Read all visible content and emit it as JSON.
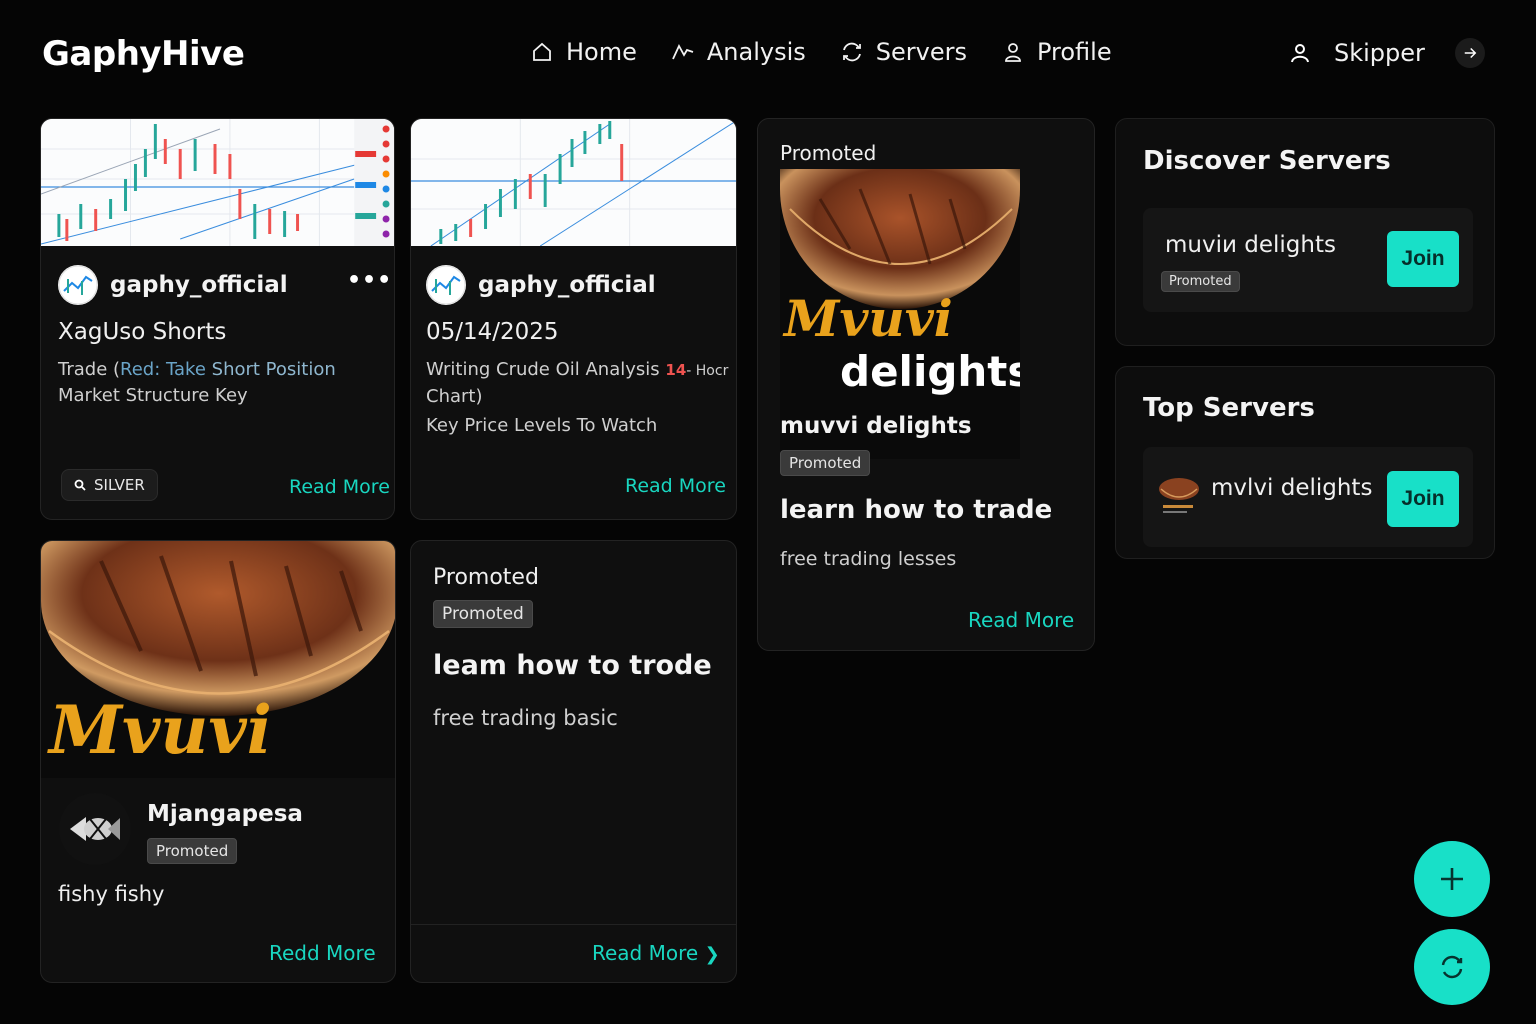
{
  "app": {
    "logo": "GaphyHive"
  },
  "nav": [
    {
      "label": "Home",
      "icon": "home-icon"
    },
    {
      "label": "Analysis",
      "icon": "analysis-icon"
    },
    {
      "label": "Servers",
      "icon": "servers-icon"
    },
    {
      "label": "Profile",
      "icon": "profile-icon"
    }
  ],
  "user": {
    "name": "Skipper"
  },
  "colors": {
    "accent": "#18e0c8",
    "background": "#050505",
    "card": "#0f0f0f"
  },
  "posts": {
    "p1": {
      "author": "gaphy_official",
      "more": "•••",
      "title": "XagUso Shorts",
      "line1_prefix": "Trade (",
      "line1_highlight": "Red: Take",
      "line1_suffix": " Short Position",
      "line2": "Market Structure Key",
      "badge": "SILVER",
      "read_more": "Read More"
    },
    "p2": {
      "author": "gaphy_official",
      "title": "05/14/2025",
      "line1": "Writing Crude Oil Analysis",
      "line1_num": "14",
      "line1_tail": "- Hocr",
      "line2": "Chart)",
      "line3": "Key Price Levels To Watch",
      "read_more": "Read More"
    },
    "p3": {
      "promoted_label": "Promoted",
      "image_script": "Mvuvi",
      "image_word": "delights",
      "name": "muvvi delights",
      "badge": "Promoted",
      "title": "learn how to trade",
      "subtitle": "free trading lesses",
      "read_more": "Read More"
    },
    "p4": {
      "image_script": "Mvuvi",
      "author": "Mjangapesa",
      "badge": "Promoted",
      "body": "fishy fishy",
      "read_more": "Redd More"
    },
    "p5": {
      "promoted_label": "Promoted",
      "badge": "Promoted",
      "title": "leam how to trode",
      "subtitle": "free trading basic",
      "read_more": "Read More",
      "chevron": "❯"
    }
  },
  "discover": {
    "title": "Discover Servers",
    "server": {
      "name": "muviи delights",
      "badge": "Promoted",
      "join": "Join"
    }
  },
  "top": {
    "title": "Top Servers",
    "server": {
      "name": "mvlvi delights",
      "join": "Join"
    }
  }
}
